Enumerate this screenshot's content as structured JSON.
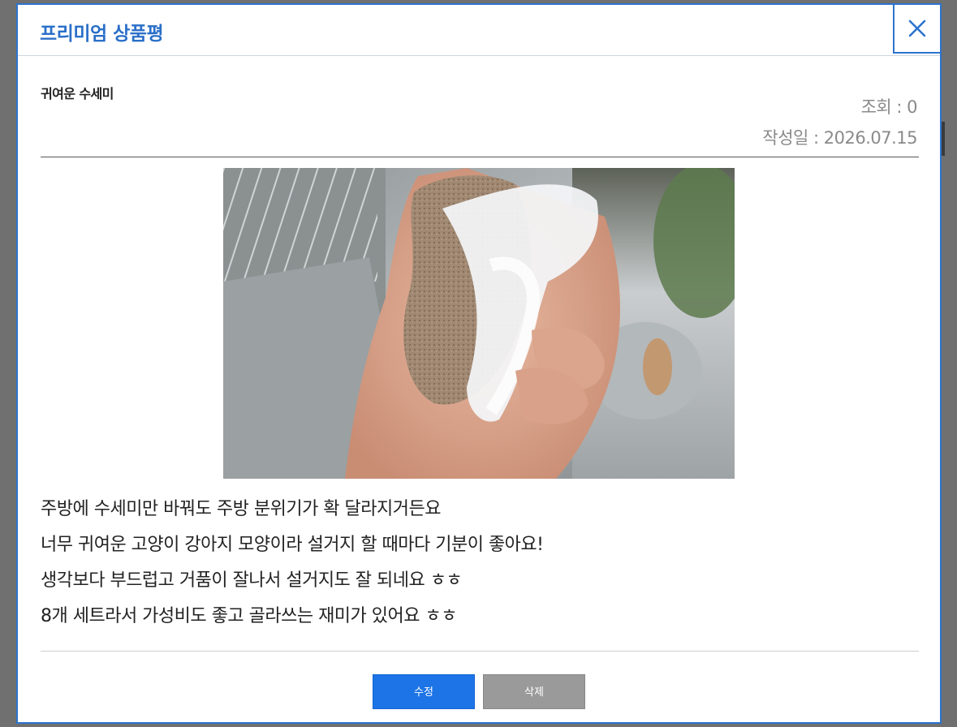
{
  "modal": {
    "title": "프리미엄 상품평",
    "close_label": "✕"
  },
  "review": {
    "title": "귀여운 수세미",
    "views": "조회 : 0",
    "date": "작성일 : 2026.07.15",
    "lines": [
      "주방에 수세미만 바꿔도 주방 분위기가 확 달라지거든요",
      "너무 귀여운 고양이 강아지 모양이라 설거지 할 때마다 기분이 좋아요!",
      "생각보다 부드럽고 거품이 잘나서 설거지도 잘 되네요 ㅎㅎ",
      "8개 세트라서 가성비도 좋고 골라쓰는 재미가 있어요 ㅎㅎ"
    ]
  },
  "actions": {
    "edit_label": "수정",
    "delete_label": "삭제"
  },
  "colors": {
    "accent": "#2a6fc8",
    "edit_button": "#1c74e6",
    "delete_button": "#9a9a9a"
  },
  "icons": {
    "close": "close-icon"
  }
}
